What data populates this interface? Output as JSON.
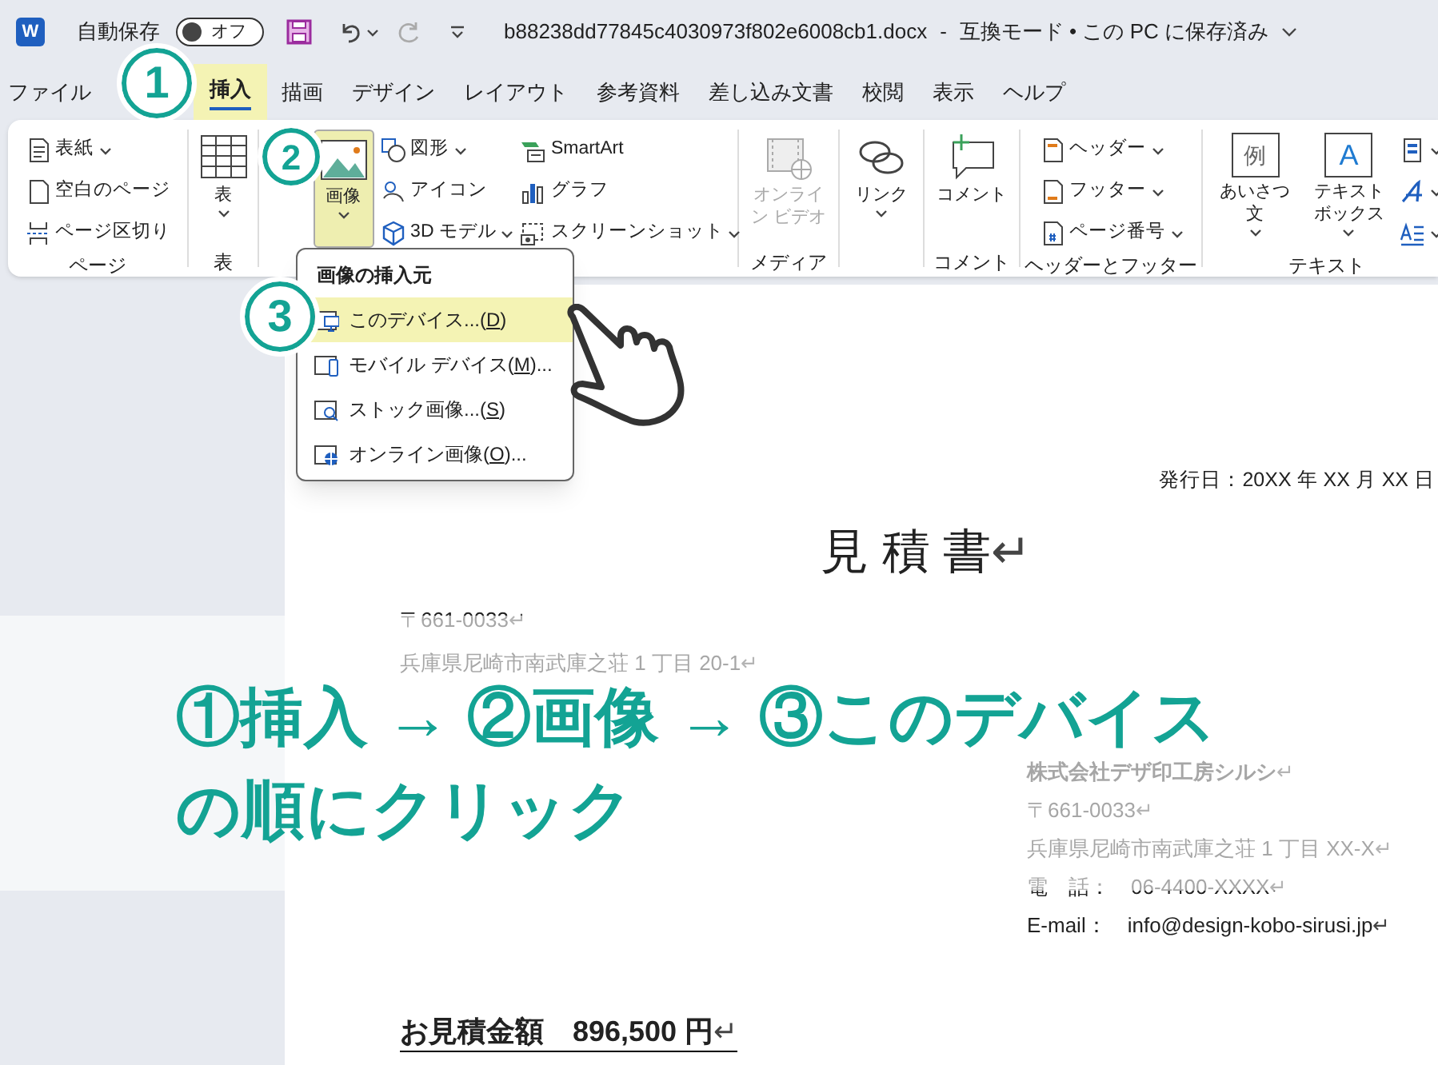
{
  "title_bar": {
    "app_icon": "W",
    "autosave_label": "自動保存",
    "autosave_toggle": {
      "label": "オフ",
      "on": false
    },
    "filename": "b88238dd77845c4030973f802e6008cb1.docx",
    "separator": "-",
    "status": "互換モード • この PC に保存済み"
  },
  "tabs": [
    {
      "label": "ファイル",
      "selected": false
    },
    {
      "label": "挿入",
      "selected": true
    },
    {
      "label": "描画",
      "selected": false
    },
    {
      "label": "デザイン",
      "selected": false
    },
    {
      "label": "レイアウト",
      "selected": false
    },
    {
      "label": "参考資料",
      "selected": false
    },
    {
      "label": "差し込み文書",
      "selected": false
    },
    {
      "label": "校閲",
      "selected": false
    },
    {
      "label": "表示",
      "selected": false
    },
    {
      "label": "ヘルプ",
      "selected": false
    }
  ],
  "ribbon": [
    {
      "label": "ページ",
      "columns": [
        [
          {
            "kind": "small",
            "label": "表紙",
            "caret": true
          },
          {
            "kind": "small",
            "label": "空白のページ",
            "caret": false
          },
          {
            "kind": "small",
            "label": "ページ区切り",
            "caret": false
          }
        ]
      ]
    },
    {
      "label": "表",
      "columns": [
        [
          {
            "kind": "large",
            "label": "表",
            "caret": true
          }
        ]
      ]
    },
    {
      "columns": [
        [
          {
            "kind": "large",
            "label": "画像",
            "caret": true,
            "pressed": true
          }
        ],
        [
          {
            "kind": "small",
            "label": "図形",
            "caret": true
          },
          {
            "kind": "small",
            "label": "アイコン",
            "caret": false
          },
          {
            "kind": "small",
            "label": "3D モデル",
            "caret": true
          }
        ],
        [
          {
            "kind": "small",
            "label": "SmartArt",
            "caret": false
          },
          {
            "kind": "small",
            "label": "グラフ",
            "caret": false
          },
          {
            "kind": "small",
            "label": "スクリーンショット",
            "caret": true
          }
        ]
      ]
    },
    {
      "label": "メディア",
      "columns": [
        [
          {
            "kind": "large",
            "label": "オンライン ビデオ",
            "caret": false,
            "disabled": true
          }
        ]
      ]
    },
    {
      "columns": [
        [
          {
            "kind": "large",
            "label": "リンク",
            "caret": true
          }
        ]
      ]
    },
    {
      "label": "コメント",
      "columns": [
        [
          {
            "kind": "large",
            "label": "コメント",
            "caret": false
          }
        ]
      ]
    },
    {
      "label": "ヘッダーとフッター",
      "columns": [
        [
          {
            "kind": "small",
            "label": "ヘッダー",
            "caret": true
          },
          {
            "kind": "small",
            "label": "フッター",
            "caret": true
          },
          {
            "kind": "small",
            "label": "ページ番号",
            "caret": true
          }
        ]
      ]
    },
    {
      "label": "テキスト",
      "columns": [
        [
          {
            "kind": "large",
            "label": "あいさつ文",
            "caret": true,
            "icon_text": "例"
          }
        ],
        [
          {
            "kind": "large",
            "label": "テキストボックス",
            "caret": true,
            "icon_text": "A"
          }
        ],
        [
          {
            "kind": "small",
            "caret": true
          },
          {
            "kind": "small",
            "caret": true
          },
          {
            "kind": "small",
            "caret": true
          }
        ]
      ]
    }
  ],
  "picture_menu": {
    "title": "画像の挿入元",
    "items": [
      {
        "text_before": "このデバイス...(",
        "access_key": "D",
        "text_after": ")",
        "selected": true
      },
      {
        "text_before": "モバイル デバイス(",
        "access_key": "M",
        "text_after": ")...",
        "selected": false
      },
      {
        "text_before": "ストック画像...(",
        "access_key": "S",
        "text_after": ")",
        "selected": false
      },
      {
        "text_before": "オンライン画像(",
        "access_key": "O",
        "text_after": ")...",
        "selected": false
      }
    ]
  },
  "document": {
    "issue_date": "発行日：20XX 年 XX 月 XX 日",
    "title": {
      "text": "見 積 書",
      "mark": "↵"
    },
    "client": [
      {
        "text": "〒661-0033",
        "mark": "↵"
      },
      {
        "text": "兵庫県尼崎市南武庫之荘 1 丁目 20-1",
        "mark": "↵"
      }
    ],
    "sender": [
      {
        "text": "株式会社デザ印工房シルシ",
        "mark": "↵",
        "bold": true
      },
      {
        "text": "〒661-0033",
        "mark": "↵",
        "bold": false
      },
      {
        "text": "兵庫県尼崎市南武庫之荘 1 丁目 XX-X",
        "mark": "↵",
        "bold": false
      },
      {
        "text": "電　話：　06-4400-XXXX",
        "mark": "↵",
        "bold": false
      },
      {
        "text": "E-mail：　info@design-kobo-sirusi.jp",
        "mark": "↵",
        "bold": false
      }
    ],
    "total": {
      "text": "お見積金額　896,500 円",
      "mark": "↵"
    }
  },
  "step_badges": [
    "1",
    "2",
    "3"
  ],
  "instruction": [
    "①挿入 → ②画像 → ③このデバイス",
    "の順にクリック"
  ]
}
